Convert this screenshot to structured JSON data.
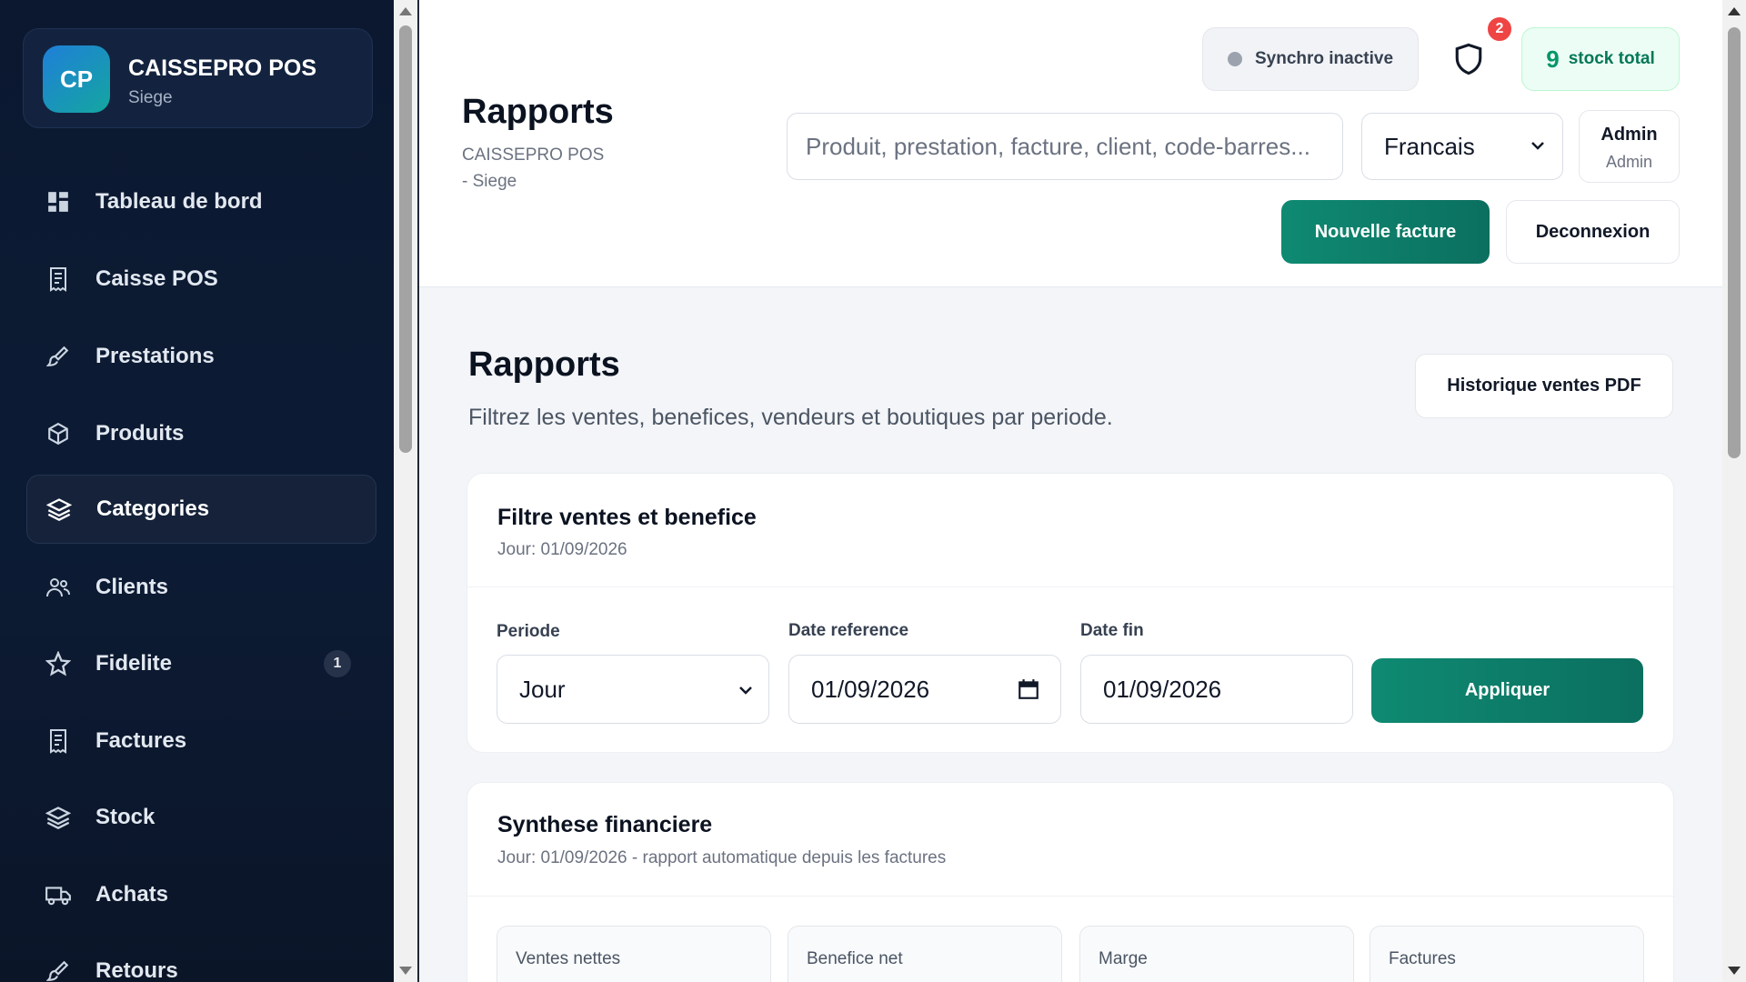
{
  "brand": {
    "logo": "CP",
    "name": "CAISSEPRO POS",
    "sub": "Siege"
  },
  "sidebar": {
    "items": [
      {
        "label": "Tableau de bord",
        "icon": "dashboard-icon"
      },
      {
        "label": "Caisse POS",
        "icon": "receipt-icon"
      },
      {
        "label": "Prestations",
        "icon": "brush-icon"
      },
      {
        "label": "Produits",
        "icon": "box-icon"
      },
      {
        "label": "Categories",
        "icon": "layers-icon",
        "active": true
      },
      {
        "label": "Clients",
        "icon": "users-icon"
      },
      {
        "label": "Fidelite",
        "icon": "star-icon",
        "badge": "1"
      },
      {
        "label": "Factures",
        "icon": "receipt-icon"
      },
      {
        "label": "Stock",
        "icon": "layers-icon"
      },
      {
        "label": "Achats",
        "icon": "truck-icon"
      },
      {
        "label": "Retours",
        "icon": "brush-icon"
      }
    ]
  },
  "header": {
    "title": "Rapports",
    "sub1": "CAISSEPRO POS",
    "sub2": "- Siege",
    "sync_label": "Synchro inactive",
    "notif_count": "2",
    "stock_count": "9",
    "stock_label": "stock total",
    "search_placeholder": "Produit, prestation, facture, client, code-barres...",
    "language": "Francais",
    "admin_name": "Admin",
    "admin_role": "Admin",
    "new_invoice": "Nouvelle facture",
    "logout": "Deconnexion"
  },
  "page": {
    "title": "Rapports",
    "subtitle": "Filtrez les ventes, benefices, vendeurs et boutiques par periode.",
    "pdf_button": "Historique ventes PDF"
  },
  "filter": {
    "title": "Filtre ventes et benefice",
    "sub": "Jour: 01/09/2026",
    "period_label": "Periode",
    "period_value": "Jour",
    "ref_label": "Date reference",
    "ref_value": "01/09/2026",
    "end_label": "Date fin",
    "end_value": "01/09/2026",
    "apply": "Appliquer"
  },
  "synthese": {
    "title": "Synthese financiere",
    "sub": "Jour: 01/09/2026 - rapport automatique depuis les factures",
    "stats": [
      "Ventes nettes",
      "Benefice net",
      "Marge",
      "Factures"
    ]
  },
  "colors": {
    "accent": "#0f8a72",
    "sidebar_bg": "#0b1830",
    "badge_red": "#ef4444"
  }
}
